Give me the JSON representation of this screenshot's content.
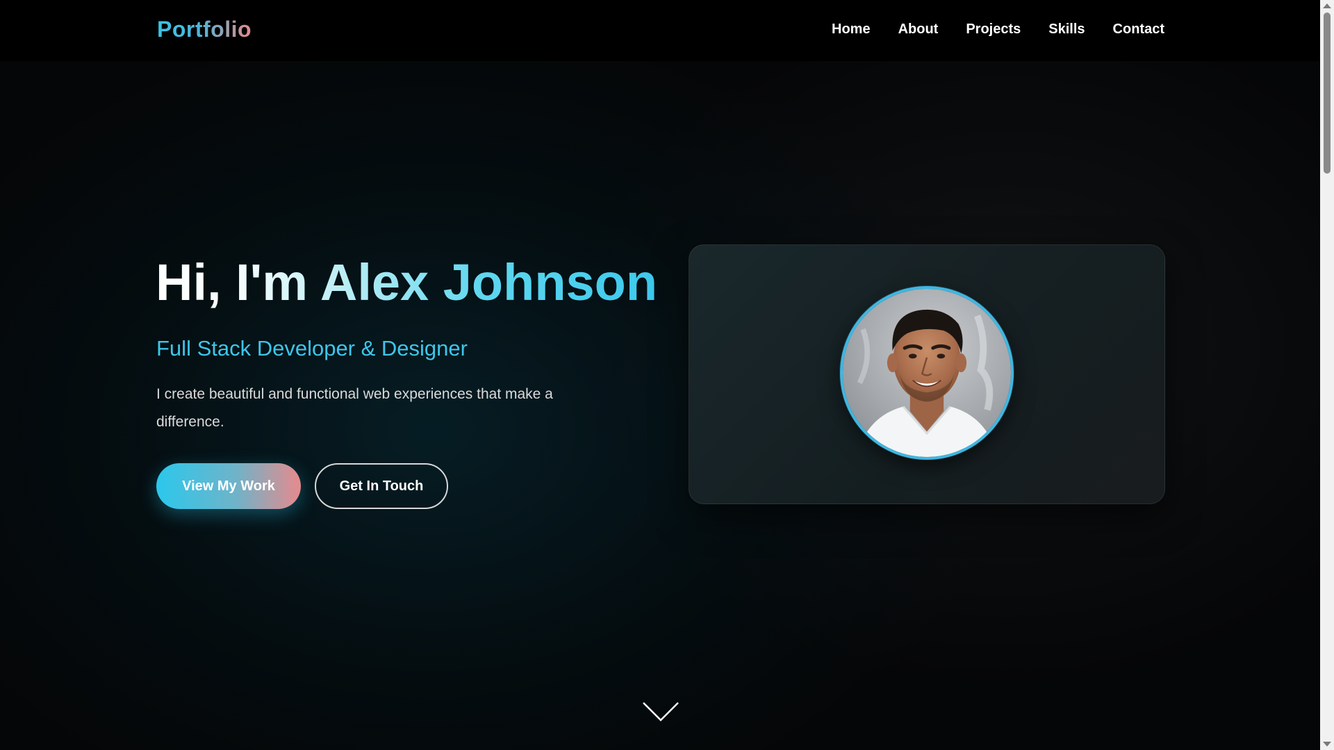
{
  "navbar": {
    "logo": "Portfolio",
    "links": [
      {
        "label": "Home"
      },
      {
        "label": "About"
      },
      {
        "label": "Projects"
      },
      {
        "label": "Skills"
      },
      {
        "label": "Contact"
      }
    ]
  },
  "hero": {
    "title": "Hi, I'm Alex Johnson",
    "subtitle": "Full Stack Developer & Designer",
    "description": "I create beautiful and functional web experiences that make a difference.",
    "primary_button": "View My Work",
    "secondary_button": "Get In Touch"
  },
  "profile": {
    "avatar_icon": "profile-photo",
    "accent_color": "#3fb7e2"
  },
  "scroll_indicator": {
    "icon": "chevron-down-icon"
  },
  "colors": {
    "accent": "#3ec6ea",
    "gradient_end": "#e78a8c",
    "background": "#050607"
  }
}
